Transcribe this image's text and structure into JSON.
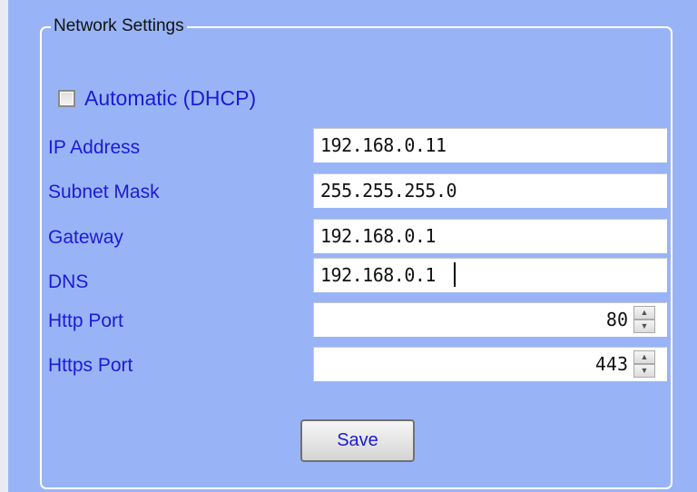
{
  "group": {
    "title": "Network Settings"
  },
  "dhcp": {
    "label": "Automatic (DHCP)",
    "checked": false
  },
  "fields": {
    "ip_address": {
      "label": "IP Address",
      "value": "192.168.0.11"
    },
    "subnet_mask": {
      "label": "Subnet Mask",
      "value": "255.255.255.0"
    },
    "gateway": {
      "label": "Gateway",
      "value": "192.168.0.1"
    },
    "dns": {
      "label": "DNS",
      "value": "192.168.0.1"
    },
    "http_port": {
      "label": "Http Port",
      "value": "80"
    },
    "https_port": {
      "label": "Https Port",
      "value": "443"
    }
  },
  "spinner": {
    "up_icon": "▲",
    "down_icon": "▼"
  },
  "save_button": {
    "label": "Save"
  }
}
